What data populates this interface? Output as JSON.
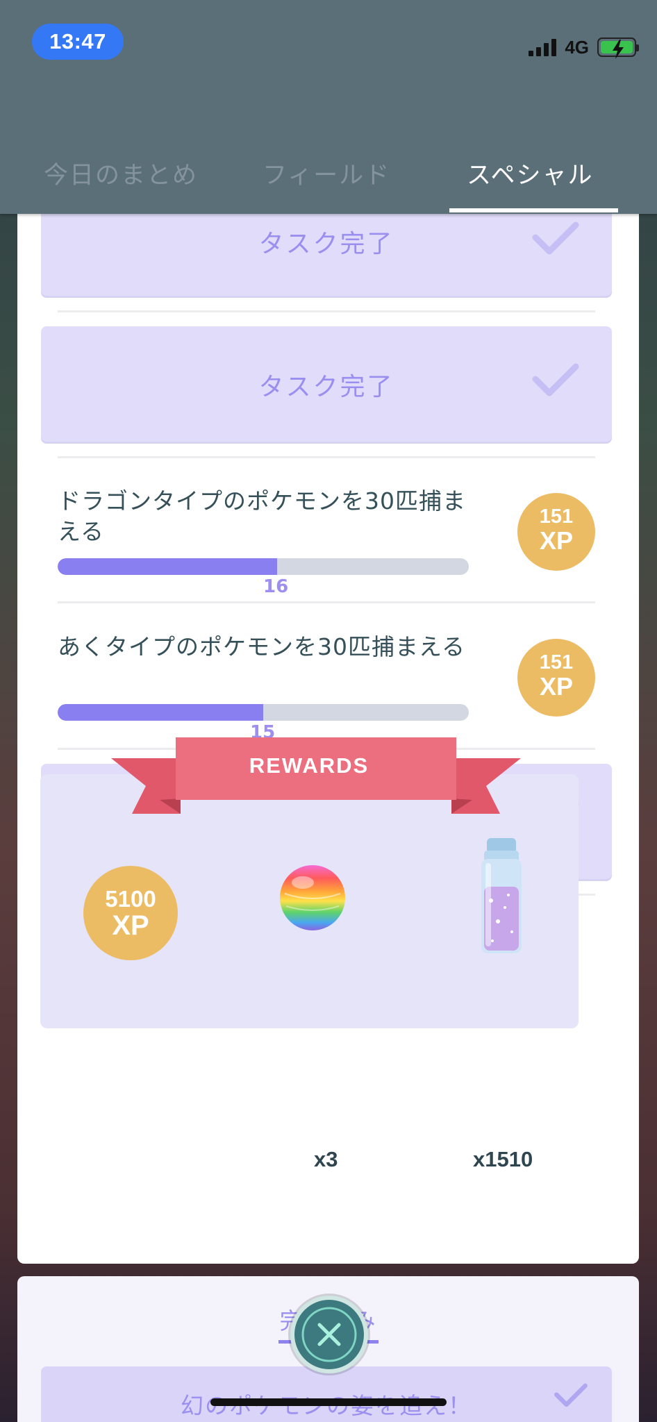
{
  "status_bar": {
    "time": "13:47",
    "network": "4G",
    "battery_state": "charging"
  },
  "tabs": [
    {
      "label": "今日のまとめ",
      "active": false
    },
    {
      "label": "フィールド",
      "active": false
    },
    {
      "label": "スペシャル",
      "active": true
    }
  ],
  "tasks": {
    "done_label": "タスク完了",
    "items": [
      {
        "text": "ドラゴンタイプのポケモンを30匹捕まえる",
        "progress": 16,
        "target": 30,
        "reward_xp": "151",
        "reward_unit": "XP"
      },
      {
        "text": "あくタイプのポケモンを30匹捕まえる",
        "progress": 15,
        "target": 30,
        "reward_xp": "151",
        "reward_unit": "XP"
      }
    ]
  },
  "rewards": {
    "title": "REWARDS",
    "xp_amount": "5100",
    "xp_unit": "XP",
    "items": [
      {
        "icon": "rainbow-ball-icon",
        "quantity": "x3"
      },
      {
        "icon": "stardust-bottle-icon",
        "quantity": "x1510"
      }
    ]
  },
  "completed_section": {
    "label": "完了済み",
    "next_quest": "幻のポケモンの姿を追え！"
  },
  "colors": {
    "header": "#5b6f78",
    "accent_purple": "#8a7ff0",
    "xp_gold": "#ecbc64",
    "ribbon_red": "#e8687a"
  }
}
